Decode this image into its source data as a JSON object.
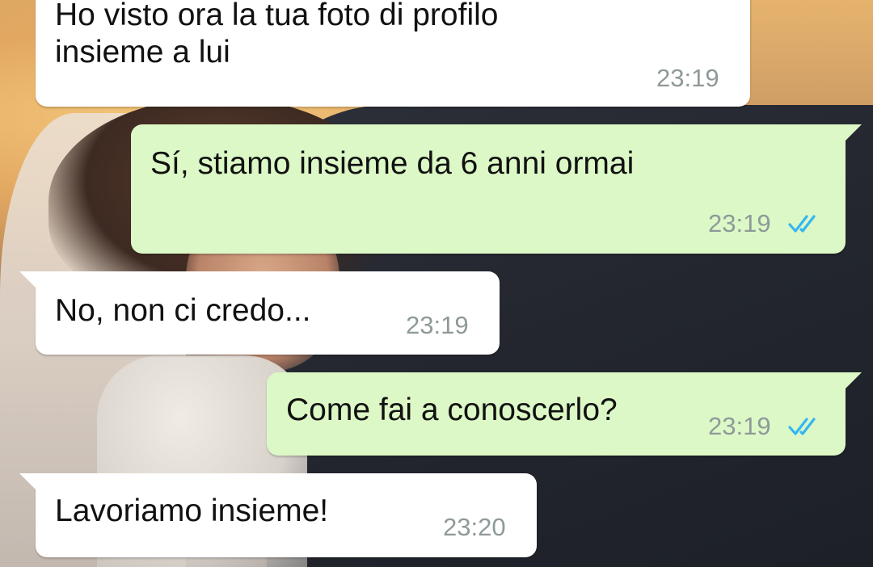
{
  "chat": {
    "colors": {
      "incoming_bubble": "#ffffff",
      "outgoing_bubble": "#dcf8c6",
      "timestamp": "#8e9a99",
      "read_ticks": "#34b7f1"
    },
    "messages": [
      {
        "direction": "incoming",
        "text": "Ho visto ora la tua foto di profilo\ninsieme a lui",
        "time": "23:19"
      },
      {
        "direction": "outgoing",
        "text": "Sí, stiamo insieme da 6 anni ormai",
        "time": "23:19",
        "status": "read",
        "status_icon": "double-check-icon"
      },
      {
        "direction": "incoming",
        "text": "No, non ci credo...",
        "time": "23:19"
      },
      {
        "direction": "outgoing",
        "text": "Come fai a conoscerlo?",
        "time": "23:19",
        "status": "read",
        "status_icon": "double-check-icon"
      },
      {
        "direction": "incoming",
        "text": "Lavoriamo insieme!",
        "time": "23:20"
      }
    ]
  }
}
